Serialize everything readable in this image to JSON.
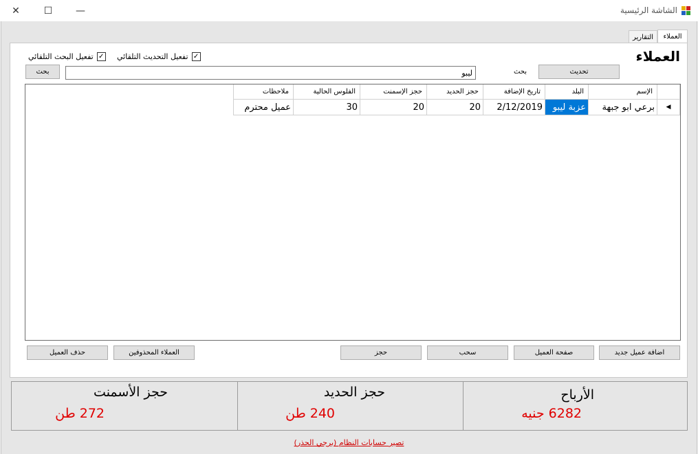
{
  "window": {
    "title": "الشاشة الرئيسية",
    "minimize_glyph": "—",
    "maximize_glyph": "☐",
    "close_glyph": "✕"
  },
  "tabs": [
    {
      "label": "العملاء",
      "active": true
    },
    {
      "label": "التقارير",
      "active": false
    }
  ],
  "customers": {
    "heading": "العملاء",
    "auto_refresh_label": "تفعيل التحديث التلقائي",
    "auto_refresh_checked": true,
    "auto_search_label": "تفعيل البحث التلقائي",
    "auto_search_checked": true,
    "refresh_button": "تحديث",
    "search_label": "بحث",
    "search_value": "ليبو",
    "search_button": "بحث"
  },
  "grid": {
    "columns": [
      "الإسم",
      "البلد",
      "تاريخ الإضافة",
      "حجز الحديد",
      "حجز الإسمنت",
      "الفلوس الحالية",
      "ملاحظات"
    ],
    "rows": [
      {
        "name": "برعي ابو جبهة",
        "country": "عزبة ليبو",
        "date_added": "2/12/2019",
        "iron_booking": "20",
        "cement_booking": "20",
        "current_money": "30",
        "notes": "عميل محترم"
      }
    ]
  },
  "actions": {
    "add_customer": "اضافة عميل جديد",
    "customer_page": "صفحة العميل",
    "withdraw": "سحب",
    "reserve": "حجز",
    "deleted_customers": "العملاء المحذوفين",
    "delete_customer": "حذف العميل"
  },
  "stats": {
    "profits_title": "الأرباح",
    "profits_value": "6282 جنيه",
    "iron_title": "حجز الحديد",
    "iron_value": "240 طن",
    "cement_title": "حجز الأسمنت",
    "cement_value": "272 طن"
  },
  "footer": {
    "reset_link": "تصير حسابات النظام (برجي الحذر)"
  },
  "colors": {
    "accent": "#0078d7",
    "stat_value": "#e00000",
    "link": "#d00000"
  }
}
